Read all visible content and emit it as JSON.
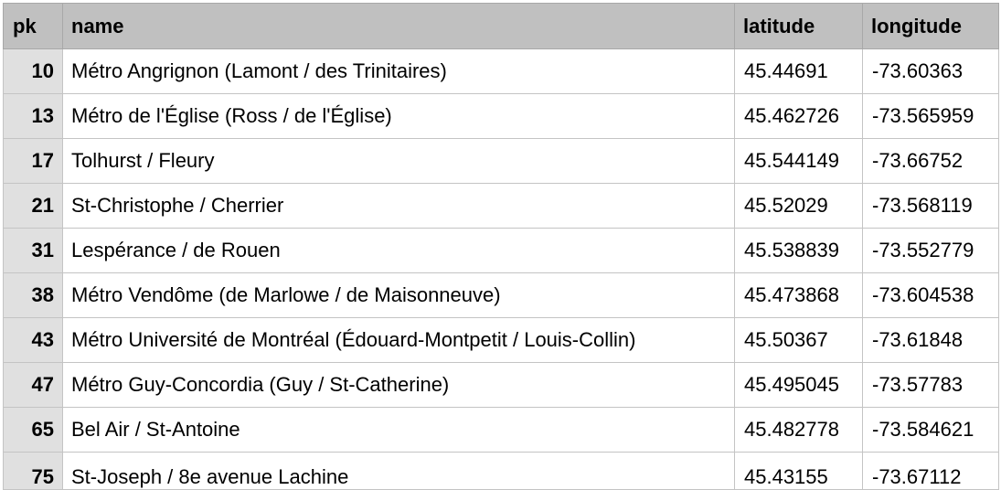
{
  "columns": [
    "pk",
    "name",
    "latitude",
    "longitude"
  ],
  "rows": [
    {
      "pk": "10",
      "name": "Métro Angrignon (Lamont /  des Trinitaires)",
      "latitude": "45.44691",
      "longitude": "-73.60363"
    },
    {
      "pk": "13",
      "name": "Métro de l'Église (Ross / de l'Église)",
      "latitude": "45.462726",
      "longitude": "-73.565959"
    },
    {
      "pk": "17",
      "name": "Tolhurst / Fleury",
      "latitude": "45.544149",
      "longitude": "-73.66752"
    },
    {
      "pk": "21",
      "name": "St-Christophe / Cherrier",
      "latitude": "45.52029",
      "longitude": "-73.568119"
    },
    {
      "pk": "31",
      "name": "Lespérance / de Rouen",
      "latitude": "45.538839",
      "longitude": "-73.552779"
    },
    {
      "pk": "38",
      "name": "Métro Vendôme (de Marlowe / de Maisonneuve)",
      "latitude": "45.473868",
      "longitude": "-73.604538"
    },
    {
      "pk": "43",
      "name": "Métro Université de Montréal (Édouard-Montpetit / Louis-Collin)",
      "latitude": "45.50367",
      "longitude": "-73.61848"
    },
    {
      "pk": "47",
      "name": "Métro Guy-Concordia (Guy / St-Catherine)",
      "latitude": "45.495045",
      "longitude": "-73.57783"
    },
    {
      "pk": "65",
      "name": "Bel Air / St-Antoine",
      "latitude": "45.482778",
      "longitude": "-73.584621"
    },
    {
      "pk": "75",
      "name": "St-Joseph / 8e avenue Lachine",
      "latitude": "45.43155",
      "longitude": "-73.67112"
    }
  ]
}
